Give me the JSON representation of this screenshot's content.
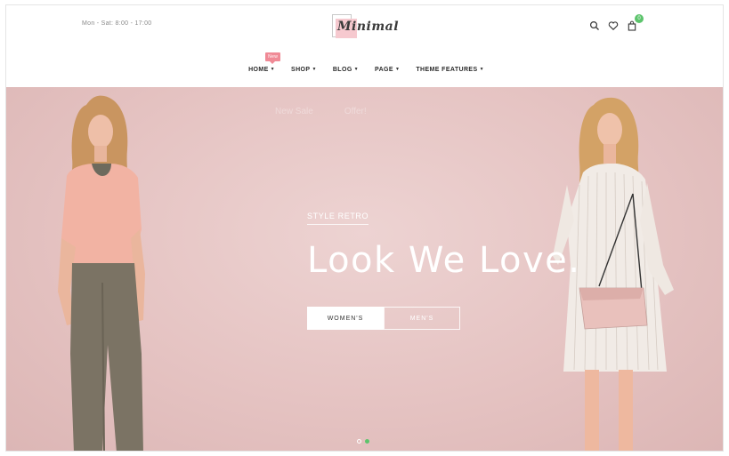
{
  "topbar": {
    "hours": "Mon - Sat: 8:00 - 17:00",
    "logo_text": "Minimal",
    "cart_count": "0",
    "icons": [
      "search-icon",
      "heart-icon",
      "bag-icon"
    ]
  },
  "nav": {
    "items": [
      {
        "label": "HOME",
        "badge": "New"
      },
      {
        "label": "SHOP"
      },
      {
        "label": "BLOG"
      },
      {
        "label": "PAGE"
      },
      {
        "label": "THEME FEATURES"
      }
    ]
  },
  "hero": {
    "ghost_tabs": [
      "New Sale",
      "Offer!"
    ],
    "eyebrow": "STYLE RETRO",
    "headline": "Look We Love.",
    "buttons": [
      "WOMEN'S",
      "MEN'S"
    ],
    "slides": 2,
    "active_slide": 2
  },
  "colors": {
    "accent_green": "#5cc46c",
    "badge_pink": "#f08a96",
    "hero_bg": "#e5c3c2"
  }
}
